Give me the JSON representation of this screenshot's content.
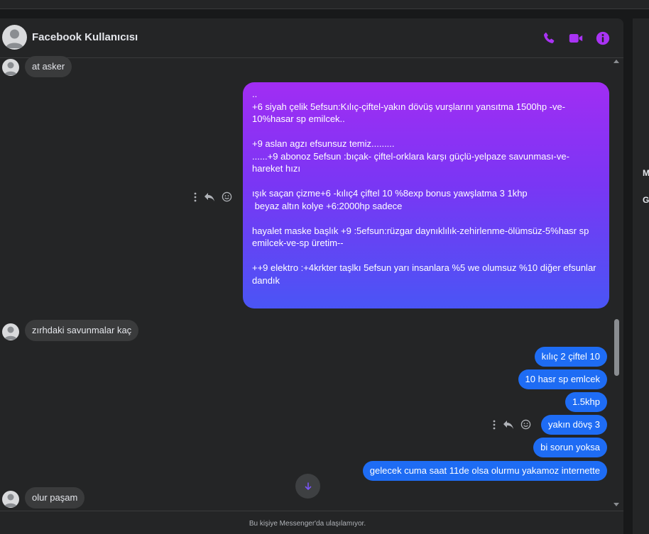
{
  "header": {
    "title": "Facebook Kullanıcısı",
    "accent_color": "#a933f4",
    "icons": [
      "phone-icon",
      "video-camera-icon",
      "info-icon"
    ]
  },
  "messages": {
    "in_1": "at asker",
    "big_out": "..\n+6 siyah çelik 5efsun:Kılıç-çiftel-yakın dövüş vurşlarını yansıtma 1500hp -ve-10%hasar sp emilcek..\n\n+9 aslan agzı efsunsuz temiz.........\n......+9 abonoz 5efsun :bıçak- çiftel-orklara karşı güçlü-yelpaze savunması-ve-hareket hızı\n\nışık saçan çizme+6 -kılıç4 çiftel 10 %8exp bonus yawşlatma 3 1khp\n beyaz altın kolye +6:2000hp sadece\n\nhayalet maske başlık +9 :5efsun:rüzgar daynıklılık-zehirlenme-ölümsüz-5%hasr sp emilcek-ve-sp üretim--\n\n++9 elektro :+4krkter taşlkı 5efsun yarı insanlara %5 we olumsuz %10 diğer efsunlar dandık",
    "in_2": "zırhdaki savunmalar kaç",
    "out_1": "kılıç 2 çiftel 10",
    "out_2": "10 hasr sp emlcek",
    "out_3": "1.5khp",
    "out_4": "yakın dövş 3",
    "out_5": "bi sorun yoksa",
    "out_6": "gelecek cuma saat 11de olsa olurmu yakamoz internette",
    "in_3": "olur paşam"
  },
  "footer": {
    "text": "Bu kişiye Messenger'da ulaşılamıyor."
  },
  "right_panel": {
    "letters": [
      "M",
      "G"
    ]
  }
}
